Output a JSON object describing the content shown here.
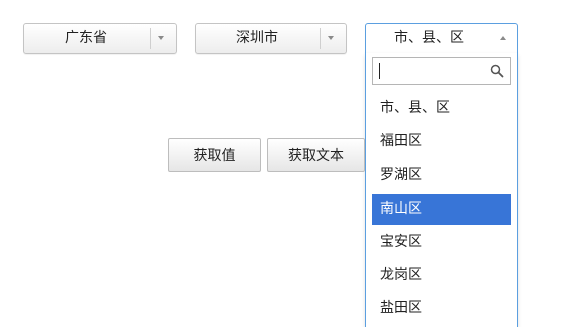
{
  "province_select": {
    "value": "广东省"
  },
  "city_select": {
    "value": "深圳市"
  },
  "district_select": {
    "value": "市、县、区",
    "search": {
      "value": "",
      "placeholder": ""
    },
    "options": [
      {
        "label": "市、县、区",
        "selected": false
      },
      {
        "label": "福田区",
        "selected": false
      },
      {
        "label": "罗湖区",
        "selected": false
      },
      {
        "label": "南山区",
        "selected": true
      },
      {
        "label": "宝安区",
        "selected": false
      },
      {
        "label": "龙岗区",
        "selected": false
      },
      {
        "label": "盐田区",
        "selected": false
      }
    ]
  },
  "buttons": {
    "get_value": "获取值",
    "get_text": "获取文本"
  },
  "colors": {
    "highlight": "#3875d7",
    "focus_border": "#5b9fe0"
  },
  "icons": {
    "search": "search-icon",
    "arrow": "chevron-down-icon",
    "arrow_up": "chevron-up-icon"
  }
}
